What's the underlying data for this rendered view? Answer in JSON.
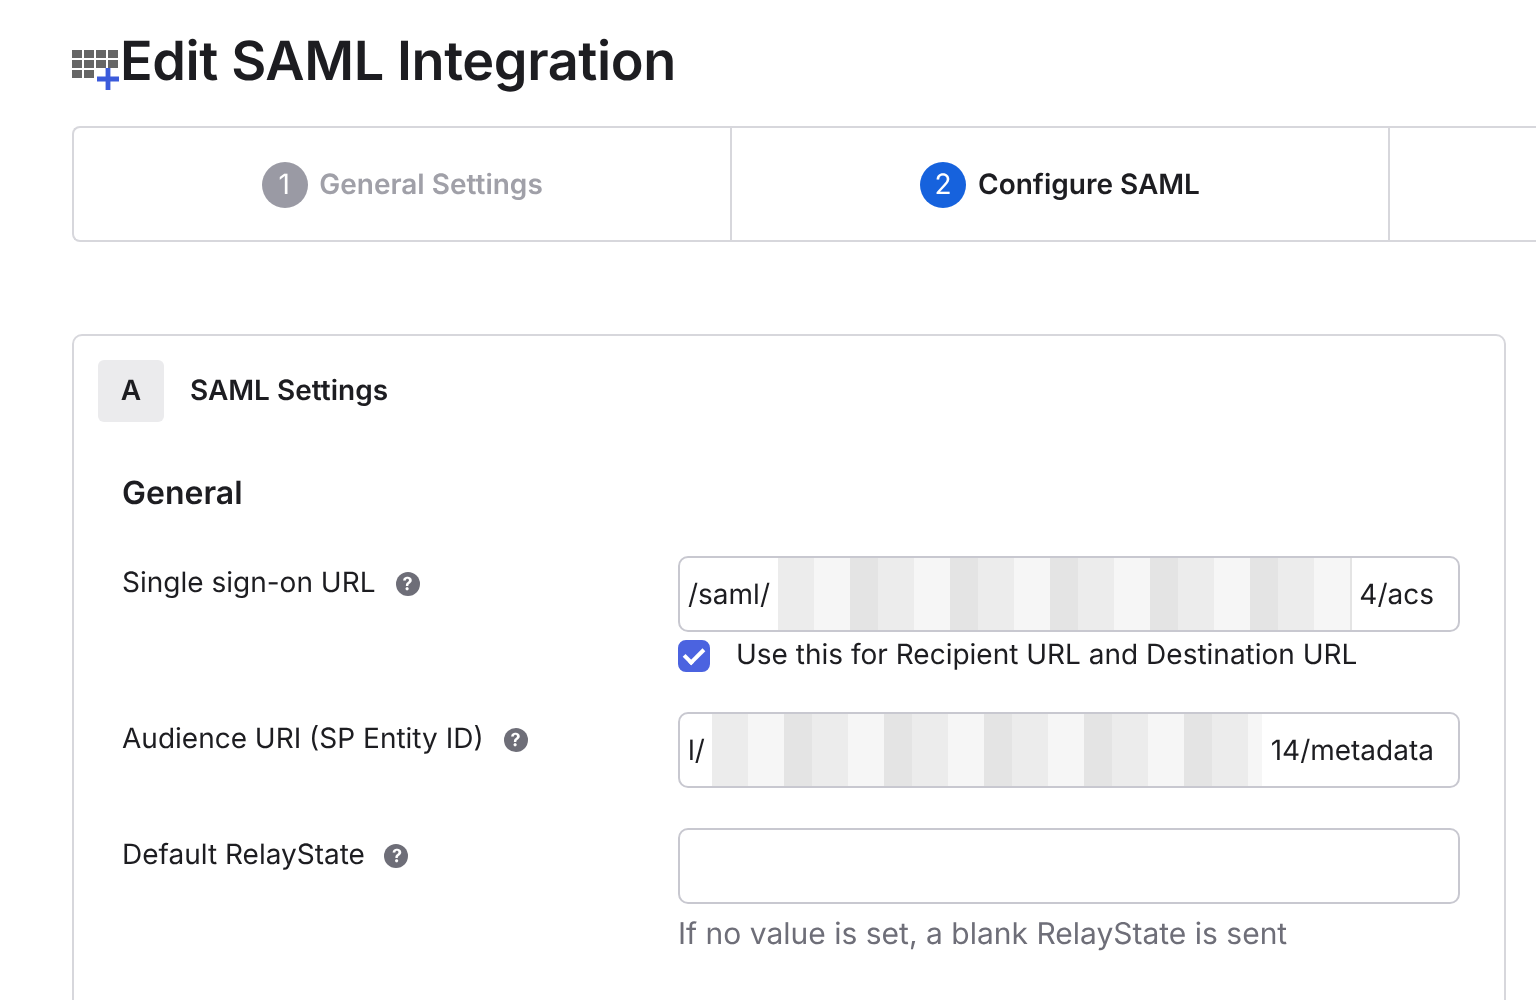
{
  "page": {
    "title": "Edit SAML Integration"
  },
  "steps": [
    {
      "number": "1",
      "label": "General Settings",
      "selected": false
    },
    {
      "number": "2",
      "label": "Configure SAML",
      "selected": true
    }
  ],
  "section": {
    "badge": "A",
    "title": "SAML Settings",
    "subtitle": "General",
    "fields": [
      {
        "label": "Single sign-on URL",
        "help": "?",
        "value_start": "/saml/",
        "value_end": "4/acs",
        "redacted": true,
        "checkbox": {
          "label": "Use this for Recipient URL and Destination URL",
          "checked": true
        }
      },
      {
        "label": "Audience URI (SP Entity ID)",
        "help": "?",
        "value_start": "l/",
        "value_end": "14/metadata",
        "redacted": true
      },
      {
        "label": "Default RelayState",
        "help": "?",
        "redacted": false,
        "hint": "If no value is set, a blank RelayState is sent"
      }
    ]
  }
}
